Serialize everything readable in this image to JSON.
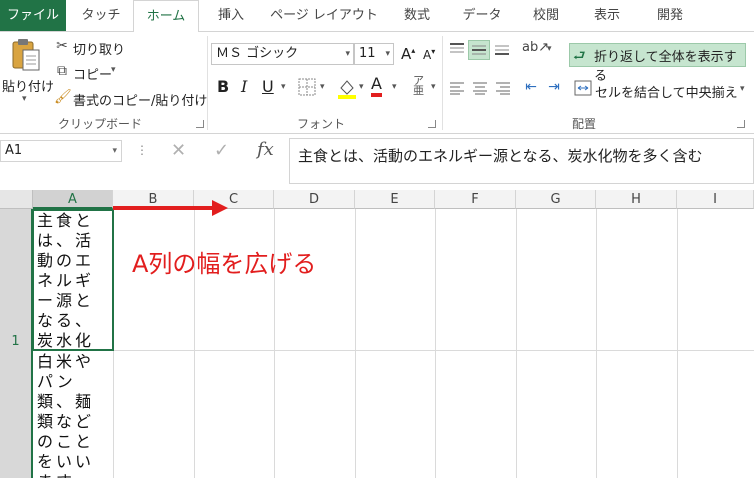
{
  "tabs": [
    "ファイル",
    "タッチ",
    "ホーム",
    "挿入",
    "ページ レイアウト",
    "数式",
    "データ",
    "校閲",
    "表示",
    "開発"
  ],
  "clipboard": {
    "paste": "貼り付け",
    "cut": "切り取り",
    "copy": "コピー",
    "format_painter": "書式のコピー/貼り付け",
    "group": "クリップボード"
  },
  "font": {
    "name": "ＭＳ ゴシック",
    "size": "11",
    "group": "フォント",
    "grow": "A",
    "shrink": "A",
    "bold": "B",
    "italic": "I",
    "underline": "U",
    "font_color": "A"
  },
  "alignment": {
    "wrap_text": "折り返して全体を表示する",
    "merge_center": "セルを結合して中央揃え",
    "group": "配置"
  },
  "formula_bar": {
    "name_box": "A1",
    "fx": "fx",
    "content": "主食とは、活動のエネルギー源となる、炭水化物を多く含む"
  },
  "columns": [
    "A",
    "B",
    "C",
    "D",
    "E",
    "F",
    "G",
    "H",
    "I"
  ],
  "rows": [
    "1"
  ],
  "cells": {
    "a1": "主食とは、活動のエネルギー源となる、炭水化物を多く含む",
    "a2": "白米やパン類、麺類などのことをいいます。炭水化物は、主"
  },
  "annotation": "A列の幅を広げる",
  "colors": {
    "accent": "#217346",
    "annotation": "#e21e1e",
    "highlight": "#c6e5cf"
  }
}
